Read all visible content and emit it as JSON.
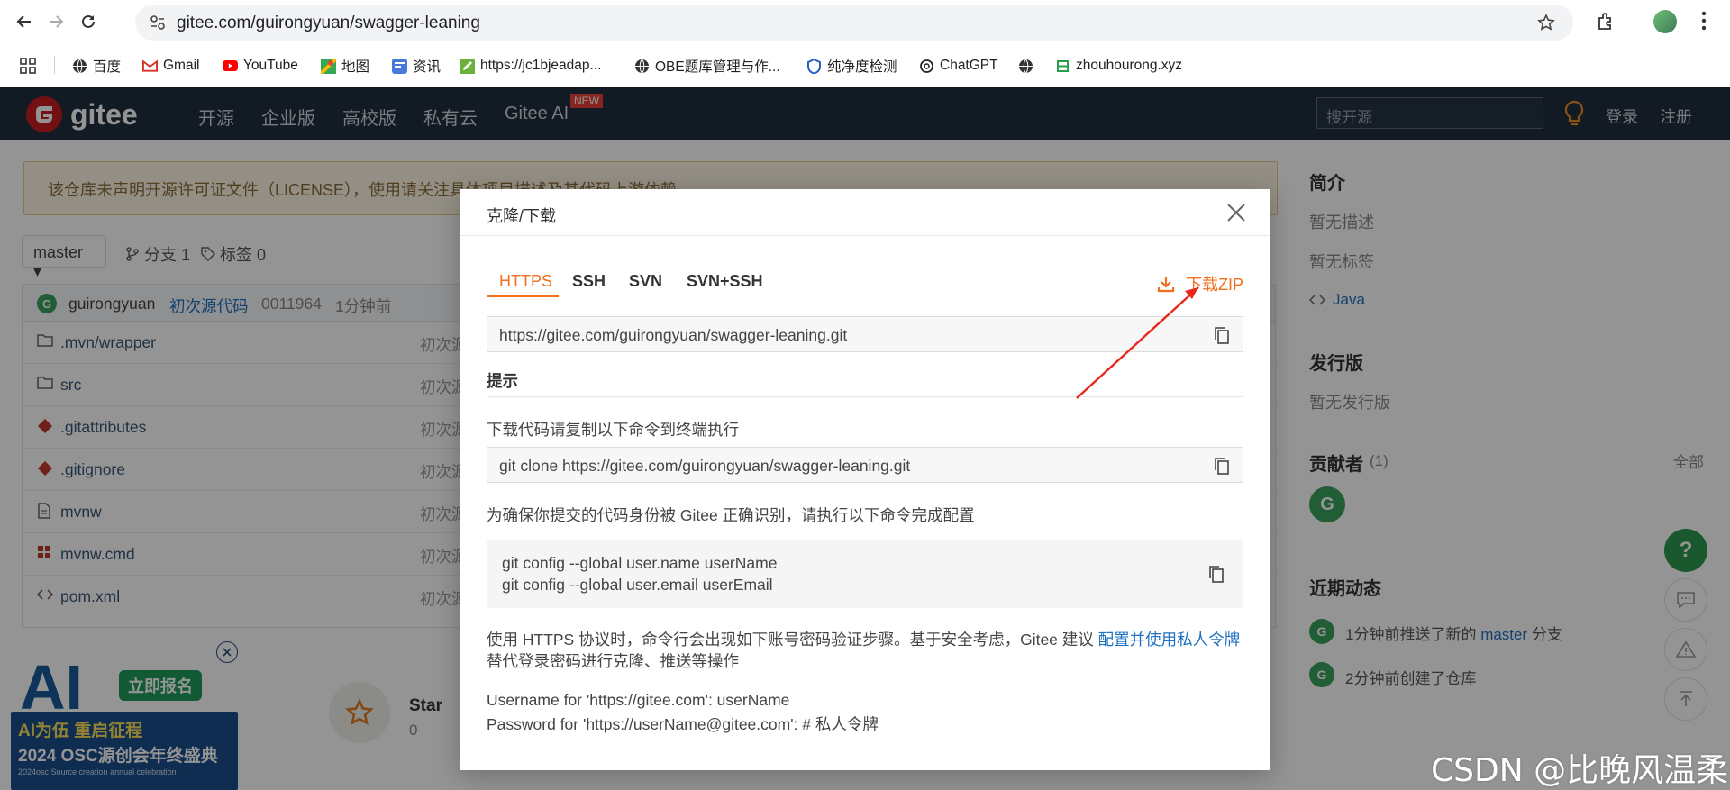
{
  "browser": {
    "url": "gitee.com/guirongyuan/swagger-leaning",
    "bookmarks": [
      "百度",
      "Gmail",
      "YouTube",
      "地图",
      "资讯",
      "https://jc1bjeadap...",
      "OBE题库管理与作...",
      "纯净度检测",
      "ChatGPT",
      "",
      "zhouhourong.xyz"
    ]
  },
  "gitee": {
    "logo": "gitee",
    "nav": [
      "开源",
      "企业版",
      "高校版",
      "私有云",
      "Gitee AI"
    ],
    "new_badge": "NEW",
    "search_placeholder": "搜开源",
    "login": "登录",
    "register": "注册",
    "notice": "该仓库未声明开源许可证文件（LICENSE），使用请关注具体项目描述及其代码上游依赖。",
    "branch": "master",
    "branches": "分支 1",
    "tags": "标签 0",
    "commit": {
      "author": "guirongyuan",
      "message": "初次源代码",
      "hash": "0011964",
      "time": "1分钟前"
    },
    "files": [
      {
        "name": ".mvn/wrapper",
        "icon": "folder-icon",
        "msg": "初次源"
      },
      {
        "name": "src",
        "icon": "folder-icon",
        "msg": "初次源"
      },
      {
        "name": ".gitattributes",
        "icon": "git-icon",
        "msg": "初次源"
      },
      {
        "name": ".gitignore",
        "icon": "git-icon",
        "msg": "初次源"
      },
      {
        "name": "mvnw",
        "icon": "file-icon",
        "msg": "初次源"
      },
      {
        "name": "mvnw.cmd",
        "icon": "windows-icon",
        "msg": "初次源"
      },
      {
        "name": "pom.xml",
        "icon": "code-icon",
        "msg": "初次源"
      }
    ],
    "star_label": "Star",
    "star_count": "0",
    "sidebar": {
      "intro_title": "简介",
      "no_desc": "暂无描述",
      "no_tags": "暂无标签",
      "language": "Java",
      "release_title": "发行版",
      "no_release": "暂无发行版",
      "contrib_title": "贡献者",
      "contrib_count": "(1)",
      "all": "全部",
      "avatar_letter": "G",
      "activity_title": "近期动态",
      "activity": [
        {
          "pre": "1分钟前推送了新的 ",
          "link": "master",
          "post": " 分支"
        },
        {
          "pre": "2分钟前创建了仓库",
          "link": "",
          "post": ""
        }
      ]
    },
    "ad": {
      "line1": "立即报名",
      "line2": "AI为伍 重启征程",
      "line3": "2024 OSC源创会年终盛典",
      "line4": "2024osc Source creation annual celebration"
    }
  },
  "modal": {
    "title": "克隆/下载",
    "tabs": [
      "HTTPS",
      "SSH",
      "SVN",
      "SVN+SSH"
    ],
    "download_zip": "下载ZIP",
    "https_url": "https://gitee.com/guirongyuan/swagger-leaning.git",
    "tip_title": "提示",
    "clone_hint": "下载代码请复制以下命令到终端执行",
    "clone_cmd": "git clone https://gitee.com/guirongyuan/swagger-leaning.git",
    "config_hint": "为确保你提交的代码身份被 Gitee 正确识别，请执行以下命令完成配置",
    "config_cmd1": "git config --global user.name userName",
    "config_cmd2": "git config --global user.email userEmail",
    "https_note_pre": "使用 HTTPS 协议时，命令行会出现如下账号密码验证步骤。基于安全考虑，Gitee 建议 ",
    "https_note_link": "配置并使用私人令牌",
    "https_note_post": "替代登录密码进行克隆、推送等操作",
    "username_line": "Username for 'https://gitee.com': userName",
    "password_line": "Password for 'https://userName@gitee.com': # 私人令牌"
  },
  "watermark": "CSDN @比晚风温柔"
}
